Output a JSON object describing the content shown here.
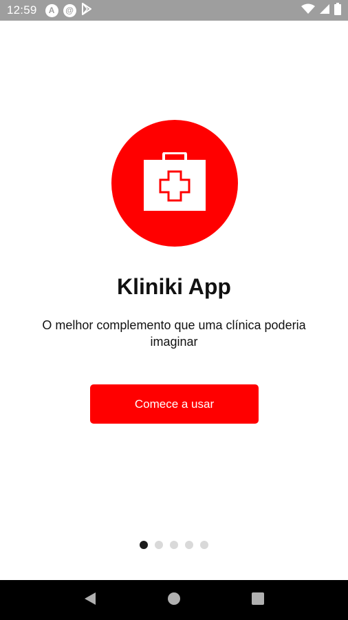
{
  "status_bar": {
    "time": "12:59",
    "left_icons": [
      {
        "name": "android-notification-icon",
        "glyph": "A"
      },
      {
        "name": "at-sign-notification-icon",
        "glyph": "@"
      },
      {
        "name": "play-store-icon"
      }
    ],
    "right_icons": [
      "wifi-icon",
      "cell-signal-icon",
      "battery-icon"
    ]
  },
  "app": {
    "title": "Kliniki App",
    "subtitle": "O melhor complemento que uma clínica poderia imaginar",
    "start_button_label": "Comece a usar",
    "logo_icon": "medical-kit-icon"
  },
  "pagination": {
    "total": 5,
    "active_index": 0
  },
  "navigation_bar": [
    "back-icon",
    "home-icon",
    "recents-icon"
  ],
  "colors": {
    "accent": "#ff0000",
    "status_bar": "#9e9e9e",
    "nav_bar": "#000000",
    "dot_active": "#1c1c1c",
    "dot_inactive": "#d9d9d9"
  }
}
